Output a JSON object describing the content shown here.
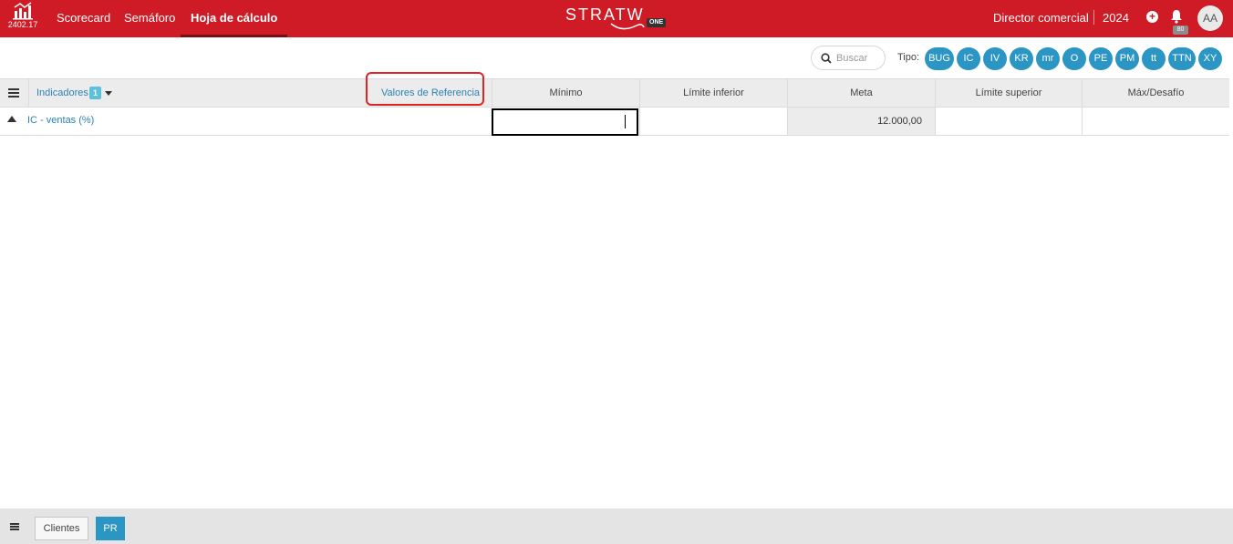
{
  "app": {
    "version": "2402.17",
    "brand": "STRATW",
    "brand_suffix": "ONE"
  },
  "nav": {
    "items": [
      {
        "label": "Scorecard"
      },
      {
        "label": "Semáforo"
      },
      {
        "label": "Hoja de cálculo"
      }
    ],
    "active": "Hoja de cálculo"
  },
  "header": {
    "role": "Director comercial",
    "year": "2024",
    "notifications": "80",
    "avatar": "AA",
    "add_icon": "plus-circle-icon",
    "bell_icon": "bell-icon"
  },
  "filters": {
    "search_placeholder": "Buscar",
    "search_value": "",
    "tipo_label": "Tipo:",
    "types": [
      "BUG",
      "IC",
      "IV",
      "KR",
      "mr",
      "O",
      "PE",
      "PM",
      "tt",
      "TTN",
      "XY"
    ]
  },
  "grid": {
    "indicators_label": "Indicadores",
    "indicators_count": "1",
    "reference_link": "Valores de Referencia",
    "columns": [
      "Mínimo",
      "Límite inferior",
      "Meta",
      "Límite superior",
      "Máx/Desafío"
    ],
    "rows": [
      {
        "name": "IC - ventas (%)",
        "minimo": "",
        "limite_inferior": "",
        "meta": "12.000,00",
        "limite_superior": "",
        "max_desafio": ""
      }
    ]
  },
  "footer": {
    "tab_label": "Clientes",
    "pr_label": "PR"
  },
  "colors": {
    "brand_red": "#cf1b25",
    "accent_blue": "#2b95c4",
    "link_blue": "#2b82b5",
    "highlight_red": "#e02424"
  }
}
